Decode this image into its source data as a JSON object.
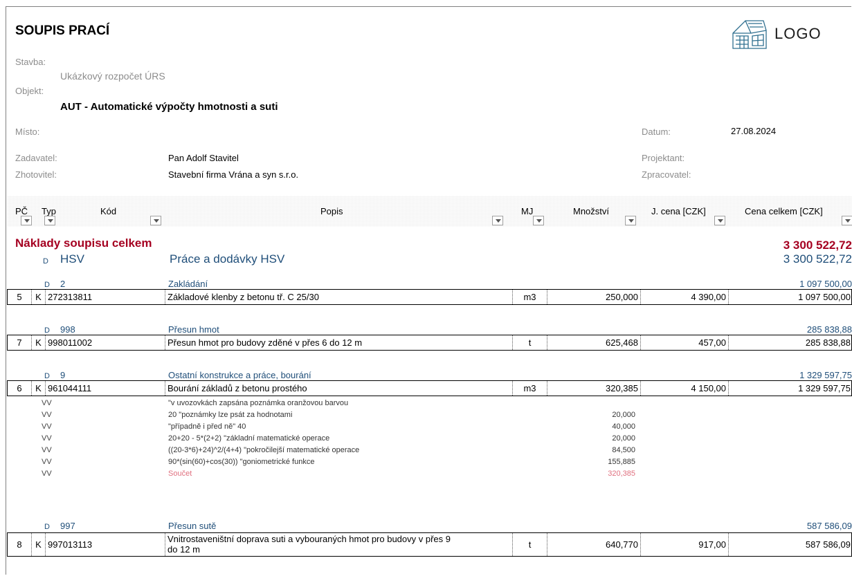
{
  "header": {
    "title": "SOUPIS PRACÍ",
    "logo_text": "LOGO",
    "stavba_label": "Stavba:",
    "stavba_value": "Ukázkový rozpočet ÚRS",
    "objekt_label": "Objekt:",
    "objekt_value": "AUT - Automatické výpočty hmotnosti a suti",
    "misto_label": "Místo:",
    "datum_label": "Datum:",
    "datum_value": "27.08.2024",
    "zadavatel_label": "Zadavatel:",
    "zadavatel_value": "Pan Adolf Stavitel",
    "projektant_label": "Projektant:",
    "zhotovitel_label": "Zhotovitel:",
    "zhotovitel_value": "Stavební firma Vrána a syn s.r.o.",
    "zpracovatel_label": "Zpracovatel:"
  },
  "columns": {
    "pc": "PČ",
    "typ": "Typ",
    "kod": "Kód",
    "popis": "Popis",
    "mj": "MJ",
    "mnozstvi": "Množství",
    "jcena": "J. cena [CZK]",
    "cena_celkem": "Cena celkem [CZK]"
  },
  "totals": {
    "label": "Náklady soupisu celkem",
    "value": "3 300 522,72"
  },
  "hsv": {
    "type": "D",
    "code": "HSV",
    "title": "Práce a dodávky HSV",
    "value": "3 300 522,72"
  },
  "groups": {
    "g1": {
      "type": "D",
      "code": "2",
      "title": "Zakládání",
      "value": "1 097 500,00",
      "item": {
        "pc": "5",
        "typ": "K",
        "kod": "272313811",
        "popis": "Základové klenby z betonu tř. C 25/30",
        "mj": "m3",
        "mnozstvi": "250,000",
        "jcena": "4 390,00",
        "cena": "1 097 500,00"
      }
    },
    "g2": {
      "type": "D",
      "code": "998",
      "title": "Přesun hmot",
      "value": "285 838,88",
      "item": {
        "pc": "7",
        "typ": "K",
        "kod": "998011002",
        "popis": "Přesun hmot pro budovy zděné v přes 6 do 12 m",
        "mj": "t",
        "mnozstvi": "625,468",
        "jcena": "457,00",
        "cena": "285 838,88"
      }
    },
    "g3": {
      "type": "D",
      "code": "9",
      "title": "Ostatní konstrukce a práce, bourání",
      "value": "1 329 597,75",
      "item": {
        "pc": "6",
        "typ": "K",
        "kod": "961044111",
        "popis": "Bourání základů z betonu prostého",
        "mj": "m3",
        "mnozstvi": "320,385",
        "jcena": "4 150,00",
        "cena": "1 329 597,75"
      }
    },
    "g4": {
      "type": "D",
      "code": "997",
      "title": "Přesun sutě",
      "value": "587 586,09",
      "item": {
        "pc": "8",
        "typ": "K",
        "kod": "997013113",
        "popis1": "Vnitrostaveništní doprava suti a vybouraných hmot pro budovy v přes 9",
        "popis2": "do 12 m",
        "mj": "t",
        "mnozstvi": "640,770",
        "jcena": "917,00",
        "cena": "587 586,09"
      }
    }
  },
  "vv": {
    "r1": {
      "tag": "VV",
      "text": "\"v uvozovkách zapsána poznámka oranžovou barvou",
      "value": ""
    },
    "r2": {
      "tag": "VV",
      "text": "20 \"poznámky lze psát za hodnotami",
      "value": "20,000"
    },
    "r3": {
      "tag": "VV",
      "text": "\"případně i před ně\" 40",
      "value": "40,000"
    },
    "r4": {
      "tag": "VV",
      "text": "20+20 - 5*(2+2) \"základní matematické operace",
      "value": "20,000"
    },
    "r5": {
      "tag": "VV",
      "text": "((20-3*6)+24)^2/(4+4) \"pokročilejší matematické operace",
      "value": "84,500"
    },
    "r6": {
      "tag": "VV",
      "text": "90*(sin(60)+cos(30)) \"goniometrické funkce",
      "value": "155,885"
    },
    "r7": {
      "tag": "VV",
      "text": "Součet",
      "value": "320,385"
    }
  }
}
